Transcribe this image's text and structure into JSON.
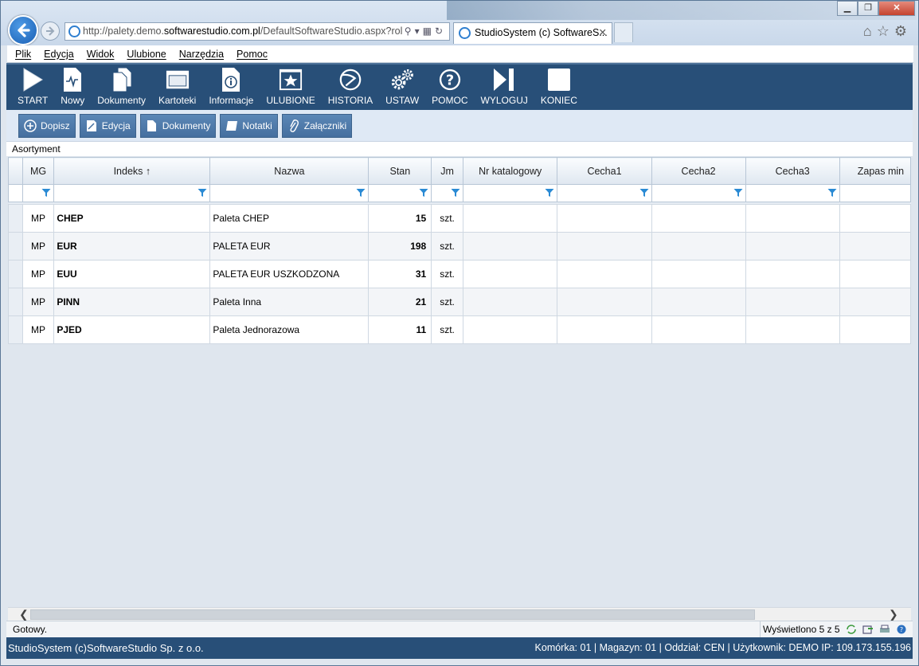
{
  "browser": {
    "address_prefix": "http://palety.demo.",
    "address_domain": "softwarestudio.com.pl",
    "address_suffix": "/DefaultSoftwareStudio.aspx?rol",
    "tab_title": "StudioSystem (c) SoftwareS...",
    "tab_close": "✕"
  },
  "menu": [
    "Plik",
    "Edycja",
    "Widok",
    "Ulubione",
    "Narzędzia",
    "Pomoc"
  ],
  "toolbar": [
    {
      "label": "START",
      "icon": "play-icon"
    },
    {
      "label": "Nowy",
      "icon": "new-document-icon"
    },
    {
      "label": "Dokumenty",
      "icon": "documents-icon"
    },
    {
      "label": "Kartoteki",
      "icon": "window-icon"
    },
    {
      "label": "Informacje",
      "icon": "info-icon"
    },
    {
      "label": "ULUBIONE",
      "icon": "star-icon"
    },
    {
      "label": "HISTORIA",
      "icon": "history-icon"
    },
    {
      "label": "USTAW",
      "icon": "gears-icon"
    },
    {
      "label": "POMOC",
      "icon": "help-icon"
    },
    {
      "label": "WYLOGUJ",
      "icon": "logout-icon"
    },
    {
      "label": "KONIEC",
      "icon": "stop-icon"
    }
  ],
  "subbar": [
    {
      "label": "Dopisz",
      "icon": "plus-circle-icon"
    },
    {
      "label": "Edycja",
      "icon": "edit-icon"
    },
    {
      "label": "Dokumenty",
      "icon": "document-icon"
    },
    {
      "label": "Notatki",
      "icon": "note-icon"
    },
    {
      "label": "Załączniki",
      "icon": "paperclip-icon"
    }
  ],
  "section_title": "Asortyment",
  "grid": {
    "columns": [
      "MG",
      "Indeks ↑",
      "Nazwa",
      "Stan",
      "Jm",
      "Nr katalogowy",
      "Cecha1",
      "Cecha2",
      "Cecha3",
      "Zapas min"
    ],
    "rows": [
      [
        "MP",
        "CHEP",
        "Paleta CHEP",
        "15",
        "szt."
      ],
      [
        "MP",
        "EUR",
        "PALETA EUR",
        "198",
        "szt."
      ],
      [
        "MP",
        "EUU",
        "PALETA EUR USZKODZONA",
        "31",
        "szt."
      ],
      [
        "MP",
        "PINN",
        "Paleta Inna",
        "21",
        "szt."
      ],
      [
        "MP",
        "PJED",
        "Paleta Jednorazowa",
        "11",
        "szt."
      ]
    ]
  },
  "status": {
    "left": "Gotowy.",
    "right": "Wyświetlono 5 z 5"
  },
  "footer": {
    "left": "StudioSystem (c)SoftwareStudio Sp. z o.o.",
    "right": "Komórka: 01 | Magazyn: 01 | Oddział: CEN | Użytkownik: DEMO IP: 109.173.155.196"
  },
  "colors": {
    "toolbar": "#284f78",
    "button": "#4f7cab",
    "funnel": "#2a8ad4"
  }
}
